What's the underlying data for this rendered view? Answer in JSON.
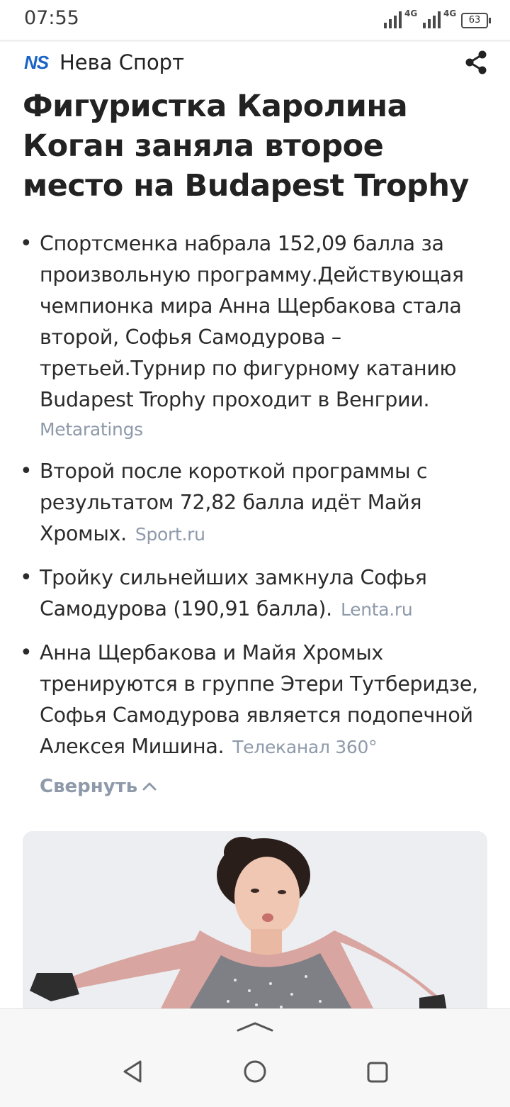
{
  "status_bar": {
    "time": "07:55",
    "network_1": "4G",
    "network_2": "4G",
    "battery": "63"
  },
  "source": {
    "logo": "NS",
    "name": "Нева Спорт"
  },
  "article": {
    "title": "Фигуристка Каролина Коган заняла второе место на Budapest Trophy",
    "bullets": [
      {
        "text": "Спортсменка набрала 152,09 балла за произвольную программу.Действующая чемпионка мира Анна Щербакова стала второй, Софья Самодурова – третьей.Турнир по фигурному катанию Budapest Trophy проходит в Венгрии.",
        "source": "Metaratings"
      },
      {
        "text": "Второй после короткой программы с результатом 72,82 балла идёт Майя Хромых.",
        "source": "Sport.ru"
      },
      {
        "text": "Тройку сильнейших замкнула Софья Самодурова (190,91 балла).",
        "source": "Lenta.ru"
      },
      {
        "text": "Анна Щербакова и Майя Хромых тренируются в группе Этери Тутберидзе, Софья Самодурова является подопечной Алексея Мишина.",
        "source": "Телеканал 360°"
      }
    ],
    "collapse_label": "Свернуть"
  },
  "colors": {
    "accent": "#1a64c8",
    "source_text": "#8e9aaa",
    "body_text": "#2b2b2b"
  }
}
